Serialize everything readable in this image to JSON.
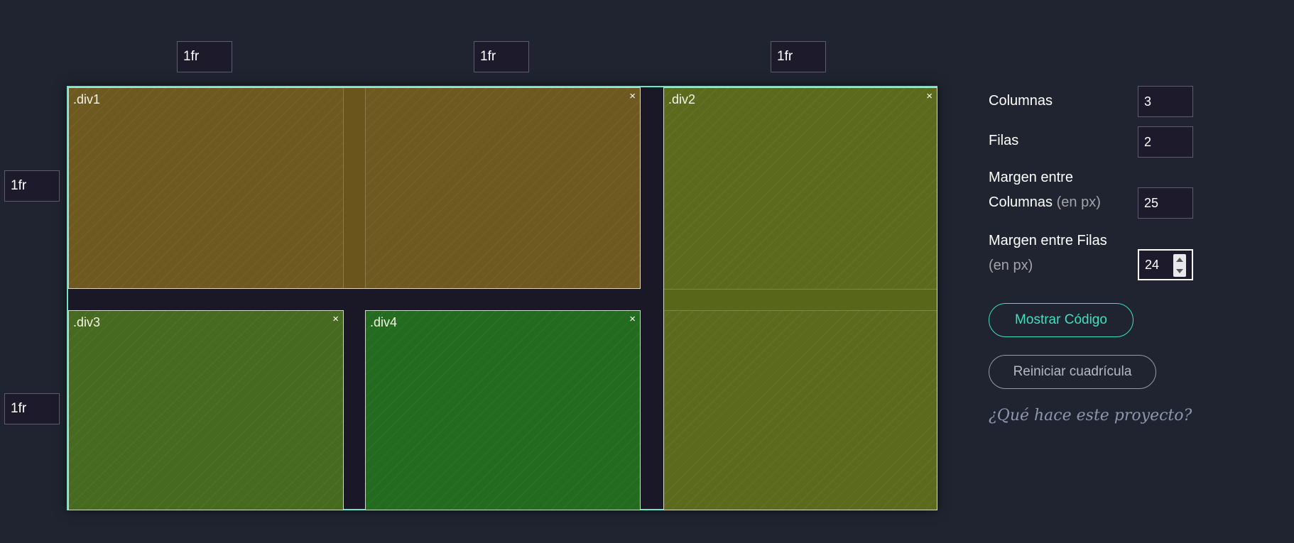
{
  "columns": {
    "tracks": [
      "1fr",
      "1fr",
      "1fr"
    ]
  },
  "rows": {
    "tracks": [
      "1fr",
      "1fr"
    ]
  },
  "grid": {
    "items": [
      {
        "label": ".div1",
        "close_icon": "×",
        "color": "#6e5a20"
      },
      {
        "label": ".div2",
        "close_icon": "×",
        "color": "#5c6a1d"
      },
      {
        "label": ".div3",
        "close_icon": "×",
        "color": "#466a1f"
      },
      {
        "label": ".div4",
        "close_icon": "×",
        "color": "#236b1e"
      }
    ],
    "border_color": "#6ee5c4"
  },
  "panel": {
    "columns_label": "Columnas",
    "columns_value": "3",
    "rows_label": "Filas",
    "rows_value": "2",
    "col_gap_label_line1": "Margen entre",
    "col_gap_label_line2": "Columnas",
    "col_gap_unit": "(en px)",
    "col_gap_value": "25",
    "row_gap_label_line1": "Margen entre Filas",
    "row_gap_unit": "(en px)",
    "row_gap_value": "24",
    "show_code_label": "Mostrar Código",
    "reset_label": "Reiniciar cuadrícula",
    "about_link": "¿Qué hace este proyecto?"
  },
  "colors": {
    "background": "#1f2430",
    "accent": "#3fe0c2"
  }
}
